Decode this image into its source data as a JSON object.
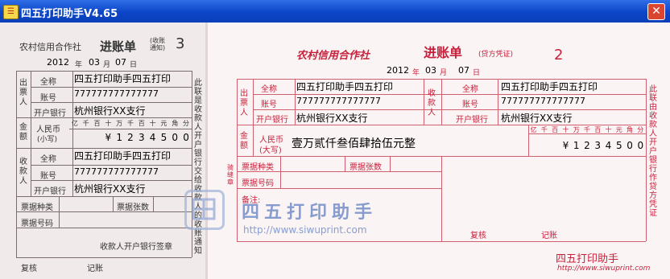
{
  "window": {
    "title": "四五打印助手V4.65",
    "close_symbol": "✕"
  },
  "stub": {
    "bank": "农村信用合作社",
    "doc_title": "进账单",
    "doc_sub": "(收账通知)",
    "copy_no": "3",
    "year": "2012",
    "y_unit": "年",
    "month": "03",
    "m_unit": "月",
    "day": "07",
    "d_unit": "日",
    "payer_side": "出票人",
    "payee_side": "收款人",
    "name_label": "全称",
    "account_label": "账号",
    "bank_label": "开户银行",
    "amount_side": "金额",
    "amount_rmb": "人民币",
    "amount_small": "(小写)",
    "digit_heads": [
      "亿",
      "千",
      "百",
      "十",
      "万",
      "千",
      "百",
      "十",
      "元",
      "角",
      "分"
    ],
    "payer_name": "四五打印助手四五打印",
    "payer_account": "777777777777777",
    "payer_bank": "杭州银行XX支行",
    "amount_digits": [
      "",
      "",
      "",
      "¥",
      "1",
      "2",
      "3",
      "4",
      "5",
      "0",
      "0"
    ],
    "payee_name": "四五打印助手四五打印",
    "payee_account": "777777777777777",
    "payee_bank": "杭州银行XX支行",
    "bill_type_label": "票据种类",
    "bill_count_label": "票据张数",
    "bill_no_label": "票据号码",
    "side_note": "此联是收款人开户银行交给收款人的收账通知",
    "stamp_label": "收款人开户银行签章",
    "review_label": "复核",
    "record_label": "记账"
  },
  "slip": {
    "bank": "农村信用合作社",
    "doc_title": "进账单",
    "doc_sub": "(贷方凭证)",
    "copy_no": "2",
    "year": "2012",
    "y_unit": "年",
    "month": "03",
    "m_unit": "月",
    "day": "07",
    "d_unit": "日",
    "payer_side": "出票人",
    "payee_side": "收款人",
    "name_label": "全称",
    "account_label": "账号",
    "bank_label": "开户银行",
    "payer_name": "四五打印助手四五打印",
    "payer_account": "777777777777777",
    "payer_bank": "杭州银行XX支行",
    "payee_name": "四五打印助手四五打印",
    "payee_account": "777777777777777",
    "payee_bank": "杭州银行XX支行",
    "amount_side": "金额",
    "amount_rmb": "人民币",
    "amount_big": "(大写)",
    "amount_words": "壹万贰仟叁佰肆拾伍元整",
    "digit_heads": [
      "亿",
      "千",
      "百",
      "十",
      "万",
      "千",
      "百",
      "十",
      "元",
      "角",
      "分"
    ],
    "amount_digits": [
      "",
      "",
      "",
      "¥",
      "1",
      "2",
      "3",
      "4",
      "5",
      "0",
      "0"
    ],
    "bill_type_label": "票据种类",
    "bill_count_label": "票据张数",
    "bill_no_label": "票据号码",
    "remark_label": "备注:",
    "review_label": "复核",
    "record_label": "记账",
    "side_note": "此联由收款人开户银行作贷方凭证",
    "left_side_note": "骑缝章",
    "footer_brand": "四五打印助手",
    "footer_url": "http://www.siwuprint.com"
  },
  "watermark": {
    "text": "四五打印助手",
    "url": "http://www.siwuprint.com"
  }
}
